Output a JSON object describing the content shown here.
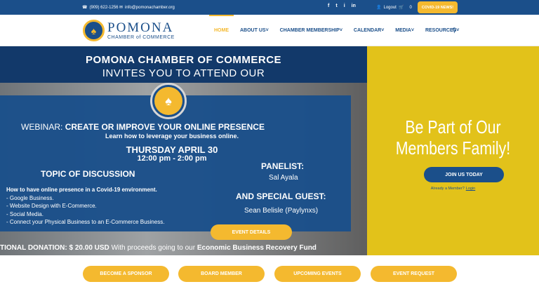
{
  "topbar": {
    "phone": "(909) 622-1256",
    "email": "info@pomonachamber.org",
    "social": [
      "f",
      "t",
      "i",
      "in"
    ],
    "logout": "Logout",
    "cart_count": "0",
    "covid": "COVID-19 NEWS!"
  },
  "logo": {
    "main": "POMONA",
    "sub": "CHAMBER of COMMERCE"
  },
  "nav": {
    "items": [
      {
        "label": "HOME"
      },
      {
        "label": "ABOUT US"
      },
      {
        "label": "CHAMBER MEMBERSHIP"
      },
      {
        "label": "CALENDAR"
      },
      {
        "label": "MEDIA"
      },
      {
        "label": "RESOURCES"
      }
    ]
  },
  "hero": {
    "title1": "POMONA CHAMBER OF COMMERCE",
    "title2": "INVITES YOU TO ATTEND OUR",
    "webinar_pre": "WEBINAR:",
    "webinar_title": "CREATE OR IMPROVE YOUR ONLINE PRESENCE",
    "leverage": "Learn how to leverage your business online.",
    "date": "THURSDAY APRIL 30",
    "time": "12:00 pm - 2:00 pm",
    "topic": "TOPIC OF DISCUSSION",
    "points": [
      "How to have online presence in a Covid-19 environment.",
      "- Google Business.",
      "- Website Design with E-Commerce.",
      "- Social Media.",
      "- Connect your Physical Business to an E-Commerce Business."
    ],
    "panelist_heading": "PANELIST:",
    "panelist": "Sal Ayala",
    "guest_heading": "AND SPECIAL GUEST:",
    "guest": "Sean Belisle (Paylynxs)",
    "event_button": "EVENT DETAILS",
    "donation_a": "TIONAL DONATION: $ 20.00 USD",
    "donation_b": "With proceeds going to our",
    "donation_c": "Economic Business Recovery Fund"
  },
  "side": {
    "title_line1": "Be Part of Our",
    "title_line2": "Members Family!",
    "join": "JOIN US TODAY",
    "already": "Already a Member?",
    "login": "Login"
  },
  "actions": [
    {
      "label": "BECOME A SPONSOR"
    },
    {
      "label": "BOARD MEMBER"
    },
    {
      "label": "UPCOMING EVENTS"
    },
    {
      "label": "EVENT REQUEST"
    }
  ],
  "colors": {
    "navy": "#1b4f8a",
    "gold": "#f4b92f",
    "side_yellow": "#e2c21a"
  }
}
